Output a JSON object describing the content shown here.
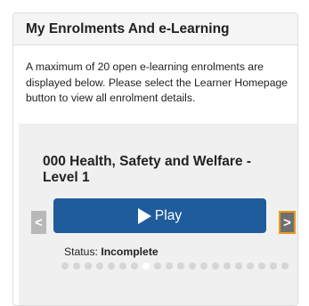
{
  "panel": {
    "title": "My Enrolments And e-Learning",
    "intro": "A maximum of 20 open e-learning enrolments are displayed below. Please select the Learner Homepage button to view all enrolment details."
  },
  "carousel": {
    "course_title": "000 Health, Safety and Welfare - Level 1",
    "play_label": "Play",
    "prev_label": "<",
    "next_label": ">",
    "status_label": "Status:",
    "status_value": "Incomplete",
    "dot_count": 20,
    "active_dot_index": 7
  },
  "colors": {
    "play_button": "#1f5c9c",
    "nav_next_border": "#e69a1e"
  }
}
